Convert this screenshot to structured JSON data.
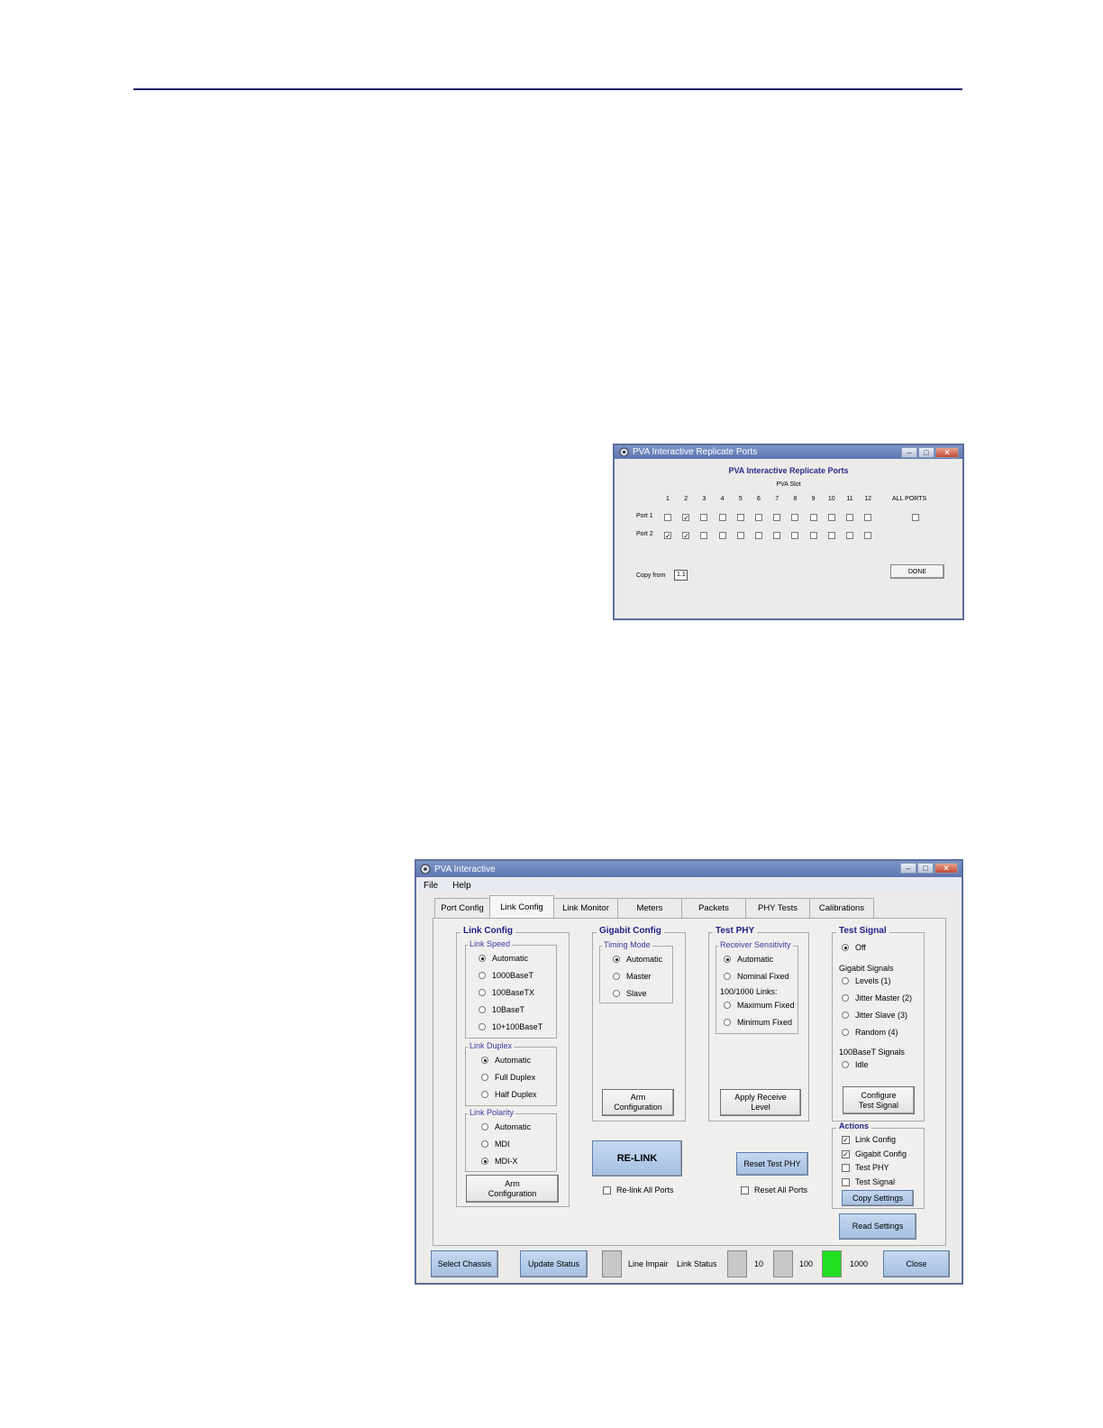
{
  "replicate": {
    "window_title": "PVA Interactive Replicate Ports",
    "heading": "PVA Interactive Replicate Ports",
    "slot_label": "PVA Slot",
    "slots": [
      "1",
      "2",
      "3",
      "4",
      "5",
      "6",
      "7",
      "8",
      "9",
      "10",
      "11",
      "12"
    ],
    "all_ports_label": "ALL PORTS",
    "rows": [
      {
        "label": "Port 1",
        "checked": [
          false,
          true,
          false,
          false,
          false,
          false,
          false,
          false,
          false,
          false,
          false,
          false
        ],
        "all": false
      },
      {
        "label": "Port 2",
        "checked": [
          true,
          true,
          false,
          false,
          false,
          false,
          false,
          false,
          false,
          false,
          false,
          false
        ]
      }
    ],
    "copy_from_label": "Copy from",
    "copy_from_value": "1.1",
    "done_label": "DONE"
  },
  "pva": {
    "window_title": "PVA Interactive",
    "menu": [
      "File",
      "Help"
    ],
    "tabs": [
      "Port Config",
      "Link Config",
      "Link Monitor",
      "Meters",
      "Packets",
      "PHY Tests",
      "Calibrations"
    ],
    "active_tab": "Link Config",
    "link_config": {
      "title": "Link Config",
      "speed_title": "Link Speed",
      "speed_options": [
        "Automatic",
        "1000BaseT",
        "100BaseTX",
        "10BaseT",
        "10+100BaseT"
      ],
      "speed_selected": 0,
      "duplex_title": "Link Duplex",
      "duplex_options": [
        "Automatic",
        "Full Duplex",
        "Half Duplex"
      ],
      "duplex_selected": 0,
      "polarity_title": "Link Polarity",
      "polarity_options": [
        "Automatic",
        "MDI",
        "MDI-X"
      ],
      "polarity_selected": 2,
      "arm_button": "Arm\nConfiguration"
    },
    "gigabit_config": {
      "title": "Gigabit Config",
      "timing_title": "Timing Mode",
      "timing_options": [
        "Automatic",
        "Master",
        "Slave"
      ],
      "timing_selected": 0,
      "arm_button": "Arm\nConfiguration"
    },
    "test_phy": {
      "title": "Test PHY",
      "sens_title": "Receiver Sensitivity",
      "opt_automatic": "Automatic",
      "opt_nominal": "Nominal Fixed",
      "links_label": "100/1000 Links:",
      "opt_maximum": "Maximum Fixed",
      "opt_minimum": "Minimum Fixed",
      "selected": "Automatic",
      "apply_button": "Apply Receive\nLevel"
    },
    "test_signal": {
      "title": "Test Signal",
      "off": "Off",
      "gig_label": "Gigabit Signals",
      "gig_options": [
        "Levels (1)",
        "Jitter Master (2)",
        "Jitter Slave (3)",
        "Random (4)"
      ],
      "base_label": "100BaseT Signals",
      "idle": "Idle",
      "selected": "Off",
      "configure_button": "Configure\nTest Signal"
    },
    "actions": {
      "title": "Actions",
      "items": [
        {
          "label": "Link Config",
          "checked": true
        },
        {
          "label": "Gigabit Config",
          "checked": true
        },
        {
          "label": "Test PHY",
          "checked": false
        },
        {
          "label": "Test Signal",
          "checked": false
        }
      ],
      "copy_button": "Copy Settings",
      "read_button": "Read Settings"
    },
    "relink_button": "RE-LINK",
    "relink_all": "Re-link All Ports",
    "reset_test_phy": "Reset Test PHY",
    "reset_all": "Reset All Ports",
    "bottom": {
      "select_chassis": "Select Chassis",
      "update_status": "Update Status",
      "line_impair": "Line Impair",
      "link_status": "Link Status",
      "speed_10": "10",
      "speed_100": "100",
      "speed_1000": "1000",
      "close": "Close",
      "active_speed_color": "#22e022",
      "inactive_color": "#c8c8c8"
    }
  }
}
